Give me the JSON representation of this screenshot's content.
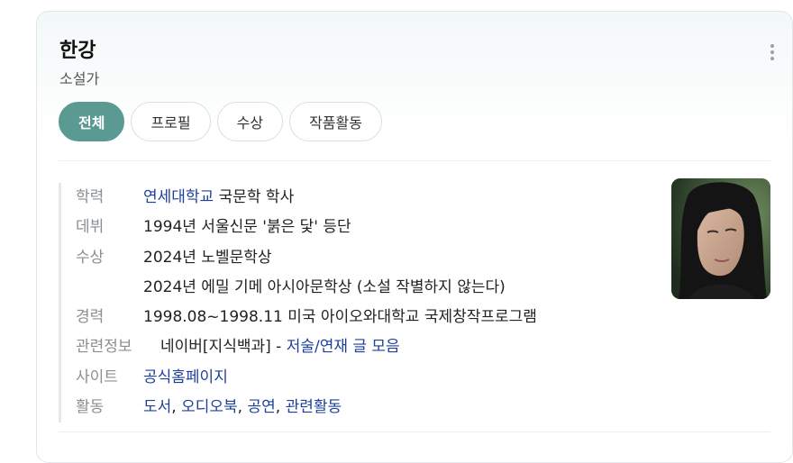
{
  "entity": {
    "name": "한강",
    "subtitle": "소설가"
  },
  "tabs": [
    {
      "label": "전체",
      "active": true
    },
    {
      "label": "프로필",
      "active": false
    },
    {
      "label": "수상",
      "active": false
    },
    {
      "label": "작품활동",
      "active": false
    }
  ],
  "info": {
    "education": {
      "label": "학력",
      "school": "연세대학교",
      "detail": " 국문학 학사"
    },
    "debut": {
      "label": "데뷔",
      "value": "1994년 서울신문 '붉은 닻' 등단"
    },
    "awards": {
      "label": "수상",
      "items": [
        "2024년 노벨문학상",
        "2024년 에밀 기메 아시아문학상 (소설 작별하지 않는다)"
      ]
    },
    "career": {
      "label": "경력",
      "value": "1998.08~1998.11 미국 아이오와대학교 국제창작프로그램"
    },
    "related": {
      "label": "관련정보",
      "source": "네이버[지식백과] - ",
      "link": "저술/연재 글 모음"
    },
    "site": {
      "label": "사이트",
      "link": "공식홈페이지"
    },
    "activity": {
      "label": "활동",
      "links": [
        "도서",
        "오디오북",
        "공연",
        "관련활동"
      ],
      "separator": ", "
    }
  },
  "colors": {
    "accent": "#5a9a92",
    "link": "#1f3f9c"
  }
}
